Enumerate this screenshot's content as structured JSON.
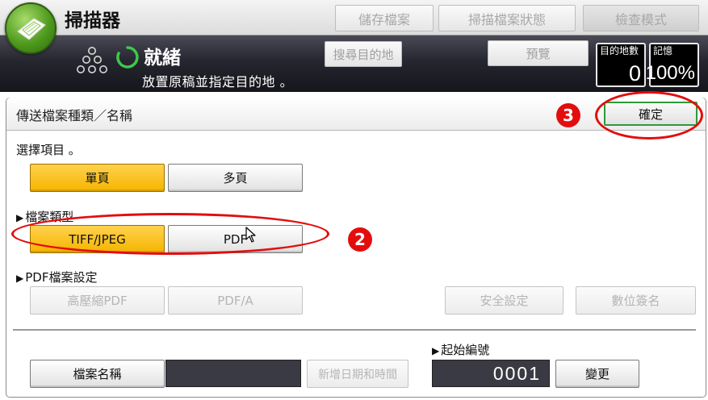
{
  "app": {
    "title": "掃描器"
  },
  "toolbar": {
    "stored_files": "儲存檔案",
    "scanned_file_status": "掃描檔案狀態",
    "check_mode": "檢查模式"
  },
  "status": {
    "title": "就緒",
    "message": "放置原稿並指定目的地 。",
    "search_destination": "搜尋目的地",
    "preview": "預覽",
    "destinations_label": "目的地數",
    "destinations_value": "0",
    "memory_label": "記憶",
    "memory_value": "100%"
  },
  "panel": {
    "title": "傳送檔案種類／名稱",
    "confirm": "確定",
    "select_prompt": "選擇項目 。",
    "page_options": [
      "單頁",
      "多頁"
    ],
    "file_type_heading": "檔案類型",
    "file_types": [
      "TIFF/JPEG",
      "PDF"
    ],
    "pdf_settings_heading": "PDF檔案設定",
    "pdf_options": [
      "高壓縮PDF",
      "PDF/A"
    ],
    "security_settings": "安全設定",
    "digital_signature": "數位簽名",
    "file_name_button": "檔案名稱",
    "add_date_time": "新增日期和時間",
    "start_number_heading": "起始編號",
    "start_number_value": "0001",
    "change": "變更"
  },
  "annotations": {
    "step2": "2",
    "step3": "3"
  },
  "colors": {
    "selected": "#f5b400",
    "annotation": "#e30d0d",
    "confirm_border": "#2e9a3a"
  }
}
